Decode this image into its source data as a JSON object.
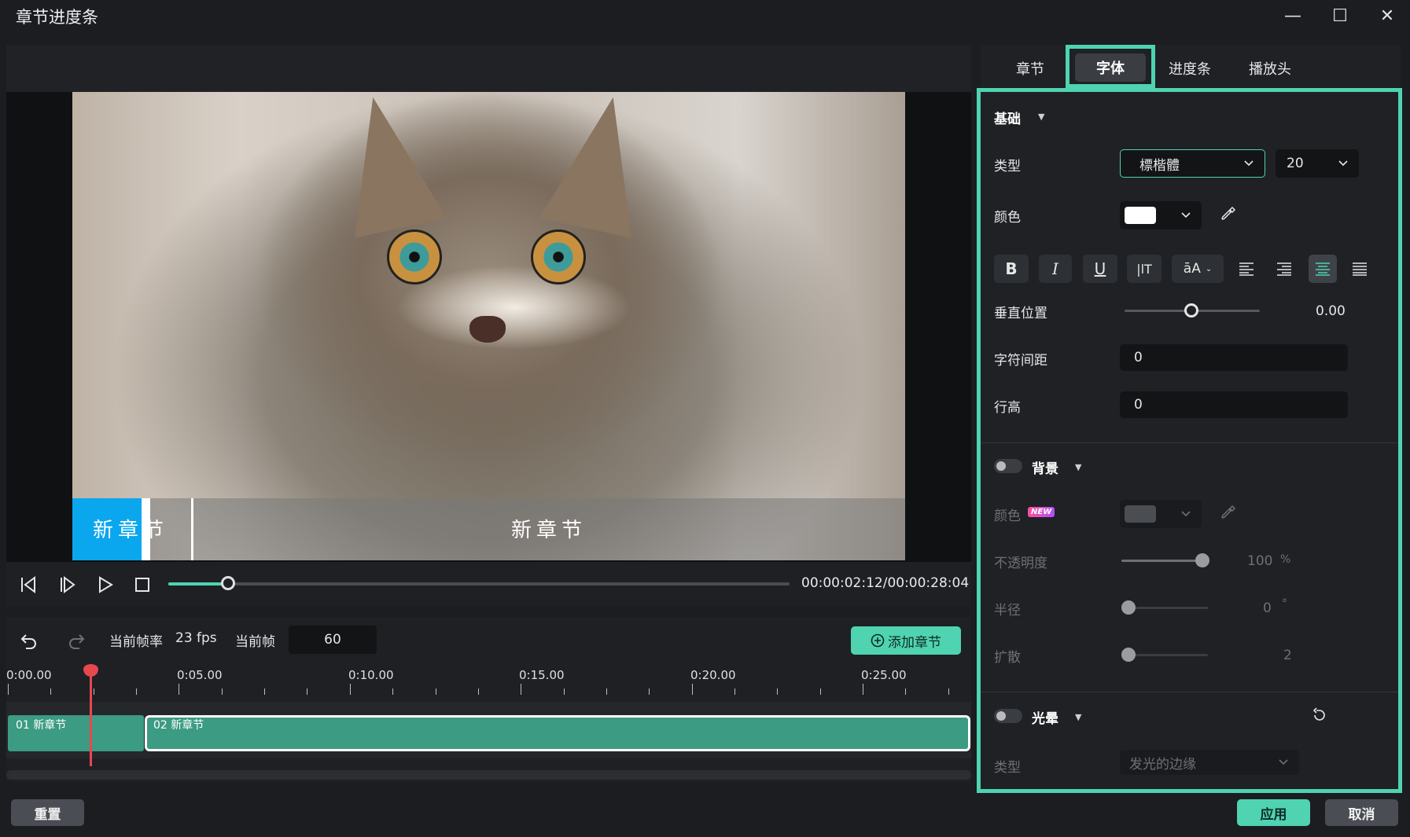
{
  "window": {
    "title": "章节进度条",
    "minimize": "—",
    "maximize": "☐",
    "close": "✕"
  },
  "preview": {
    "chapter_text_1": "新章节",
    "chapter_text_2": "新章节",
    "timecode": "00:00:02:12/00:00:28:04",
    "progress": 0.096
  },
  "timeline": {
    "frame_rate_label": "当前帧率",
    "frame_rate_value": "23 fps",
    "current_frame_label": "当前帧",
    "current_frame_value": "60",
    "add_chapter_label": "添加章节",
    "ruler": [
      "0:00.00",
      "0:05.00",
      "0:10.00",
      "0:15.00",
      "0:20.00",
      "0:25.00"
    ],
    "clips": [
      "01 新章节",
      "02 新章节"
    ]
  },
  "tabs": [
    "章节",
    "字体",
    "进度条",
    "播放头"
  ],
  "active_tab": "字体",
  "panel": {
    "basic": {
      "title": "基础",
      "type_label": "类型",
      "font_value": "標楷體",
      "size_value": "20",
      "color_label": "颜色",
      "vertical_label": "垂直位置",
      "vertical_value": "0.00",
      "spacing_label": "字符间距",
      "spacing_value": "0",
      "line_height_label": "行高",
      "line_height_value": "0",
      "format_buttons": [
        "B",
        "I",
        "U",
        "|lT",
        "āA"
      ]
    },
    "background": {
      "title": "背景",
      "color_label": "颜色",
      "new_badge": "NEW",
      "opacity_label": "不透明度",
      "opacity_value": "100",
      "opacity_unit": "%",
      "radius_label": "半径",
      "radius_value": "0",
      "radius_unit": "°",
      "spread_label": "扩散",
      "spread_value": "2"
    },
    "glow": {
      "title": "光晕",
      "type_label": "类型",
      "type_value": "发光的边缘"
    }
  },
  "footer": {
    "reset": "重置",
    "apply": "应用",
    "cancel": "取消"
  },
  "colors": {
    "accent": "#4fd3b1",
    "chapter_blue": "#0aa6ee",
    "clip": "#3c9b83",
    "playhead": "#e8474f"
  }
}
